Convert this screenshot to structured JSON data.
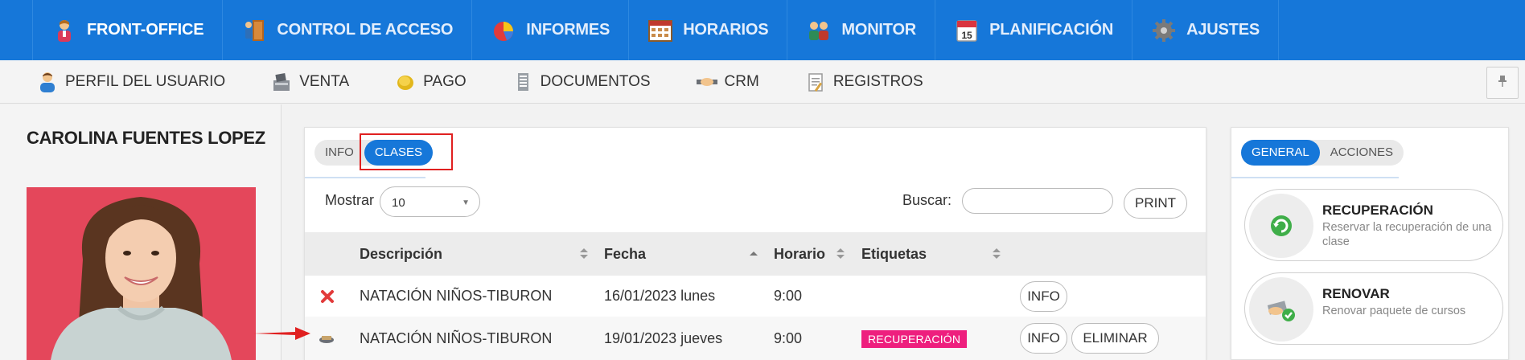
{
  "top_nav": {
    "items": [
      {
        "label": "FRONT-OFFICE",
        "icon": "receptionist-icon",
        "active": true
      },
      {
        "label": "CONTROL DE ACCESO",
        "icon": "door-access-icon",
        "active": false
      },
      {
        "label": "INFORMES",
        "icon": "pie-chart-icon",
        "active": false
      },
      {
        "label": "HORARIOS",
        "icon": "calendar-grid-icon",
        "active": false
      },
      {
        "label": "MONITOR",
        "icon": "users-monitor-icon",
        "active": false
      },
      {
        "label": "PLANIFICACIÓN",
        "icon": "calendar-15-icon",
        "active": false
      },
      {
        "label": "AJUSTES",
        "icon": "gear-icon",
        "active": false
      }
    ],
    "calendar_day": "15"
  },
  "sub_nav": {
    "items": [
      {
        "label": "PERFIL DEL USUARIO",
        "icon": "user-profile-icon"
      },
      {
        "label": "VENTA",
        "icon": "cash-register-icon"
      },
      {
        "label": "PAGO",
        "icon": "coin-icon"
      },
      {
        "label": "DOCUMENTOS",
        "icon": "documents-icon"
      },
      {
        "label": "CRM",
        "icon": "handshake-icon"
      },
      {
        "label": "REGISTROS",
        "icon": "notepad-icon"
      }
    ],
    "pin_icon": "pin-icon"
  },
  "profile": {
    "name": "CAROLINA FUENTES LOPEZ",
    "photo_bg": "#e4475b"
  },
  "center": {
    "tabs": [
      {
        "label": "INFO",
        "active": false
      },
      {
        "label": "CLASES",
        "active": true
      }
    ],
    "show_label": "Mostrar",
    "page_size": "10",
    "search_label": "Buscar:",
    "search_value": "",
    "print_label": "PRINT",
    "columns": [
      "Descripción",
      "Fecha",
      "Horario",
      "Etiquetas"
    ],
    "rows": [
      {
        "status_icon": "close-x-icon",
        "description": "NATACIÓN NIÑOS-TIBURON",
        "date": "16/01/2023 lunes",
        "time": "9:00",
        "tag": "",
        "actions": [
          "INFO"
        ]
      },
      {
        "status_icon": "recovery-ticket-icon",
        "description": "NATACIÓN NIÑOS-TIBURON",
        "date": "19/01/2023 jueves",
        "time": "9:00",
        "tag": "RECUPERACIÓN",
        "actions": [
          "INFO",
          "ELIMINAR"
        ]
      }
    ],
    "tag_color": "#ee1f7e"
  },
  "right": {
    "tabs": [
      {
        "label": "GENERAL",
        "active": true
      },
      {
        "label": "ACCIONES",
        "active": false
      }
    ],
    "actions": [
      {
        "title": "RECUPERACIÓN",
        "description": "Reservar la recuperación de una clase",
        "icon": "recycle-icon"
      },
      {
        "title": "RENOVAR",
        "description": "Renovar paquete de cursos",
        "icon": "renew-ticket-icon"
      }
    ]
  },
  "colors": {
    "primary": "#1677d9",
    "highlight": "#e02020",
    "badge": "#ee1f7e"
  }
}
